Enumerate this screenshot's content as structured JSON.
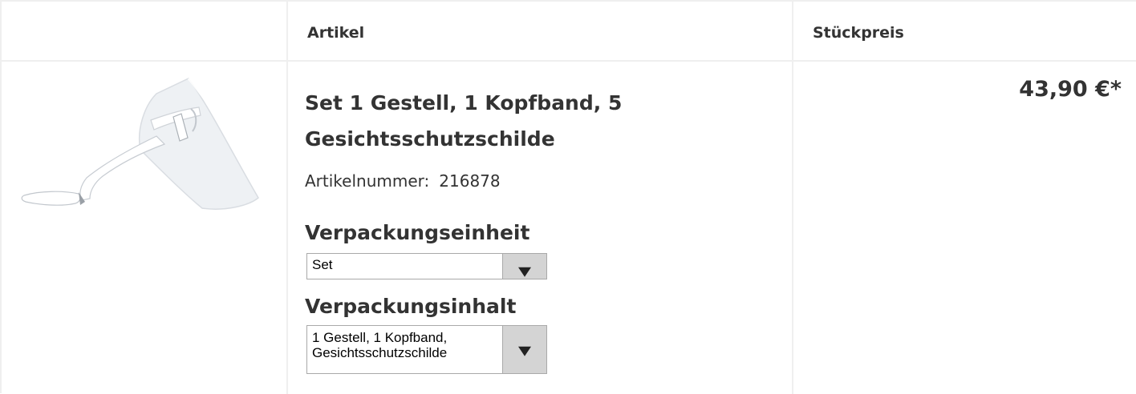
{
  "header": {
    "col_artikel": "Artikel",
    "col_stueckpreis": "Stückpreis"
  },
  "product": {
    "image_icon": "face-shield-product-image",
    "title_line1": "Set 1 Gestell, 1 Kopfband, 5",
    "title_line2": "Gesichtsschutzschilde",
    "article_number_label": "Artikelnummer:",
    "article_number_value": "216878",
    "packaging_unit_label": "Verpackungseinheit",
    "packaging_unit_value": "Set",
    "packaging_content_label": "Verpackungsinhalt",
    "packaging_content_line1": "1 Gestell, 1 Kopfband,",
    "packaging_content_line2": "Gesichtsschutzschilde",
    "price": "43,90 €*"
  },
  "colors": {
    "border": "#efefef",
    "text": "#333333",
    "select_button": "#d4d4d4"
  }
}
